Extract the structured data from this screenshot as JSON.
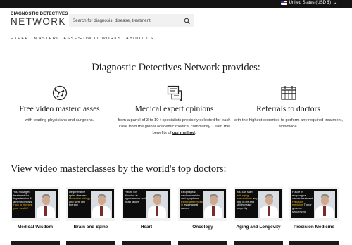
{
  "topbar": {
    "currency_label": "United States (USD $)",
    "flag_icon": "us-flag-icon",
    "caret_icon": "chevron-down-icon"
  },
  "header": {
    "logo_top": "DIAGNOSTIC DETECTIVES",
    "logo_bottom": "NETWORK",
    "search_placeholder": "Search for diagnosis, disease, treatment",
    "search_icon": "search-icon"
  },
  "nav": {
    "items": [
      {
        "label": "EXPERT MASTERCLASSES"
      },
      {
        "label": "HOW IT WORKS"
      },
      {
        "label": "ABOUT US"
      }
    ]
  },
  "provides": {
    "title": "Diagnostic Detectives Network provides:",
    "features": [
      {
        "icon": "network-globe-icon",
        "title": "Free video masterclasses",
        "desc": "with leading physicians and surgeons."
      },
      {
        "icon": "chat-document-icon",
        "title": "Medical expert opinions",
        "desc": "from a panel of 3 to 10+ specialists precisely selected for each case from the global academic medical community. Learn the benefits of",
        "link": "our method",
        "suffix": "."
      },
      {
        "icon": "calendar-grid-icon",
        "title": "Referrals to doctors",
        "desc": "with the highest expertise to perform any required treatment, worldwide."
      }
    ]
  },
  "masterclasses": {
    "title": "View video masterclasses by the world's top doctors:",
    "cards": [
      {
        "label": "Medical Wisdom",
        "thumb_text": [
          "You must get ",
          "treatment for ",
          "hypertension & ",
          "atherosclerosis. ",
          "How to improve ",
          "your health?"
        ],
        "highlight": [
          4,
          5
        ]
      },
      {
        "label": "Brain and Spine",
        "thumb_text": [
          "Degenerative ",
          "spine disease: ",
          "Molecular biology ",
          "and stem cell ",
          "therapy"
        ],
        "highlight": [
          2
        ]
      },
      {
        "label": "Heart",
        "thumb_text": [
          "Future for ",
          "diuretics in ",
          "hypertension ",
          "and heart failure"
        ],
        "highlight": []
      },
      {
        "label": "Oncology",
        "thumb_text": [
          "Esophageal ",
          "carcinoma risks ",
          "and symptoms. ",
          "Ethnic ",
          "differences in ",
          "esophageal cancer"
        ],
        "highlight": [
          3,
          4
        ]
      },
      {
        "label": "Aging and Longevity",
        "thumb_text": [
          "You can start ",
          "anti-aging ",
          "interventions ",
          "any time in life and ",
          "still increase ",
          "longevity"
        ],
        "highlight": [
          1,
          2
        ]
      },
      {
        "label": "Precision Medicine",
        "thumb_text": [
          "Future in ",
          "esophageal cancer ",
          "treatment: ",
          "Precision medicine ",
          "Tumor genome ",
          "sequencing"
        ],
        "highlight": [
          3
        ]
      }
    ]
  }
}
